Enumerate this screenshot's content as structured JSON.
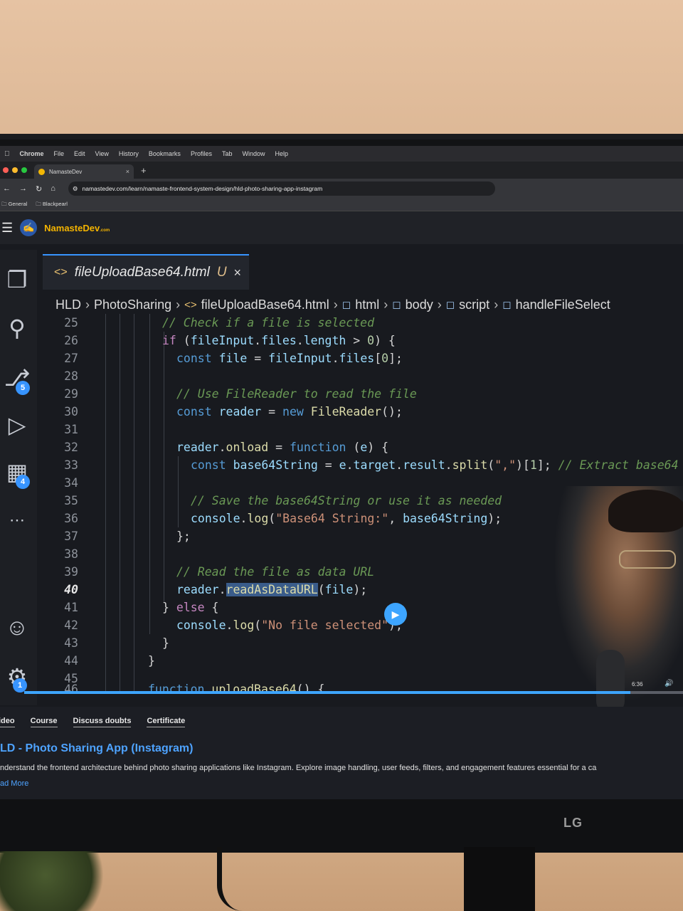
{
  "menubar": {
    "apple_icon": "apple-icon",
    "items": [
      "Chrome",
      "File",
      "Edit",
      "View",
      "History",
      "Bookmarks",
      "Profiles",
      "Tab",
      "Window",
      "Help"
    ]
  },
  "browser": {
    "tab_title": "NamasteDev",
    "tab_close": "×",
    "new_tab": "+",
    "url": "namastedev.com/learn/namaste-frontend-system-design/hld-photo-sharing-app-instagram",
    "bookmarks": [
      "General",
      "Blackpearl"
    ]
  },
  "site": {
    "brand": "NamasteDev",
    "brand_suffix": ".com"
  },
  "editor": {
    "tab_filename": "fileUploadBase64.html",
    "tab_status": "U",
    "tab_close": "×",
    "breadcrumb": [
      "HLD",
      "PhotoSharing",
      "fileUploadBase64.html",
      "html",
      "body",
      "script",
      "handleFileSelect"
    ],
    "active_line": 40,
    "badges": {
      "source_control": "5",
      "extensions": "4",
      "settings": "1"
    },
    "lines": [
      {
        "n": "25",
        "code": "// Check if a file is selected"
      },
      {
        "n": "26",
        "code": "if (fileInput.files.length > 0) {"
      },
      {
        "n": "27",
        "code": "const file = fileInput.files[0];"
      },
      {
        "n": "28",
        "code": ""
      },
      {
        "n": "29",
        "code": "// Use FileReader to read the file"
      },
      {
        "n": "30",
        "code": "const reader = new FileReader();"
      },
      {
        "n": "31",
        "code": ""
      },
      {
        "n": "32",
        "code": "reader.onload = function (e) {"
      },
      {
        "n": "33",
        "code": "const base64String = e.target.result.split(\",\")[1]; // Extract base64 d"
      },
      {
        "n": "34",
        "code": ""
      },
      {
        "n": "35",
        "code": "// Save the base64String or use it as needed"
      },
      {
        "n": "36",
        "code": "console.log(\"Base64 String:\", base64String);"
      },
      {
        "n": "37",
        "code": "};"
      },
      {
        "n": "38",
        "code": ""
      },
      {
        "n": "39",
        "code": "// Read the file as data URL"
      },
      {
        "n": "40",
        "code": "reader.readAsDataURL(file);"
      },
      {
        "n": "41",
        "code": "} else {"
      },
      {
        "n": "42",
        "code": "console.log(\"No file selected\");"
      },
      {
        "n": "43",
        "code": "}"
      },
      {
        "n": "44",
        "code": "}"
      },
      {
        "n": "45",
        "code": ""
      },
      {
        "n": "46",
        "code": "function uploadBase64() {"
      }
    ]
  },
  "video": {
    "time": "6:36",
    "progress": 0.92
  },
  "course": {
    "tabs": [
      "ideo",
      "Course",
      "Discuss doubts",
      "Certificate"
    ],
    "title": "LD - Photo Sharing App (Instagram)",
    "description": "nderstand the frontend architecture behind photo sharing applications like Instagram. Explore image handling, user feeds, filters, and engagement features essential for a ca",
    "read_more": "ad More"
  },
  "monitor": {
    "brand": "LG"
  },
  "colors": {
    "accent": "#3da5ff",
    "brand": "#f4b400",
    "keyword": "#569cd6",
    "comment": "#6a9955",
    "string": "#ce9178"
  }
}
